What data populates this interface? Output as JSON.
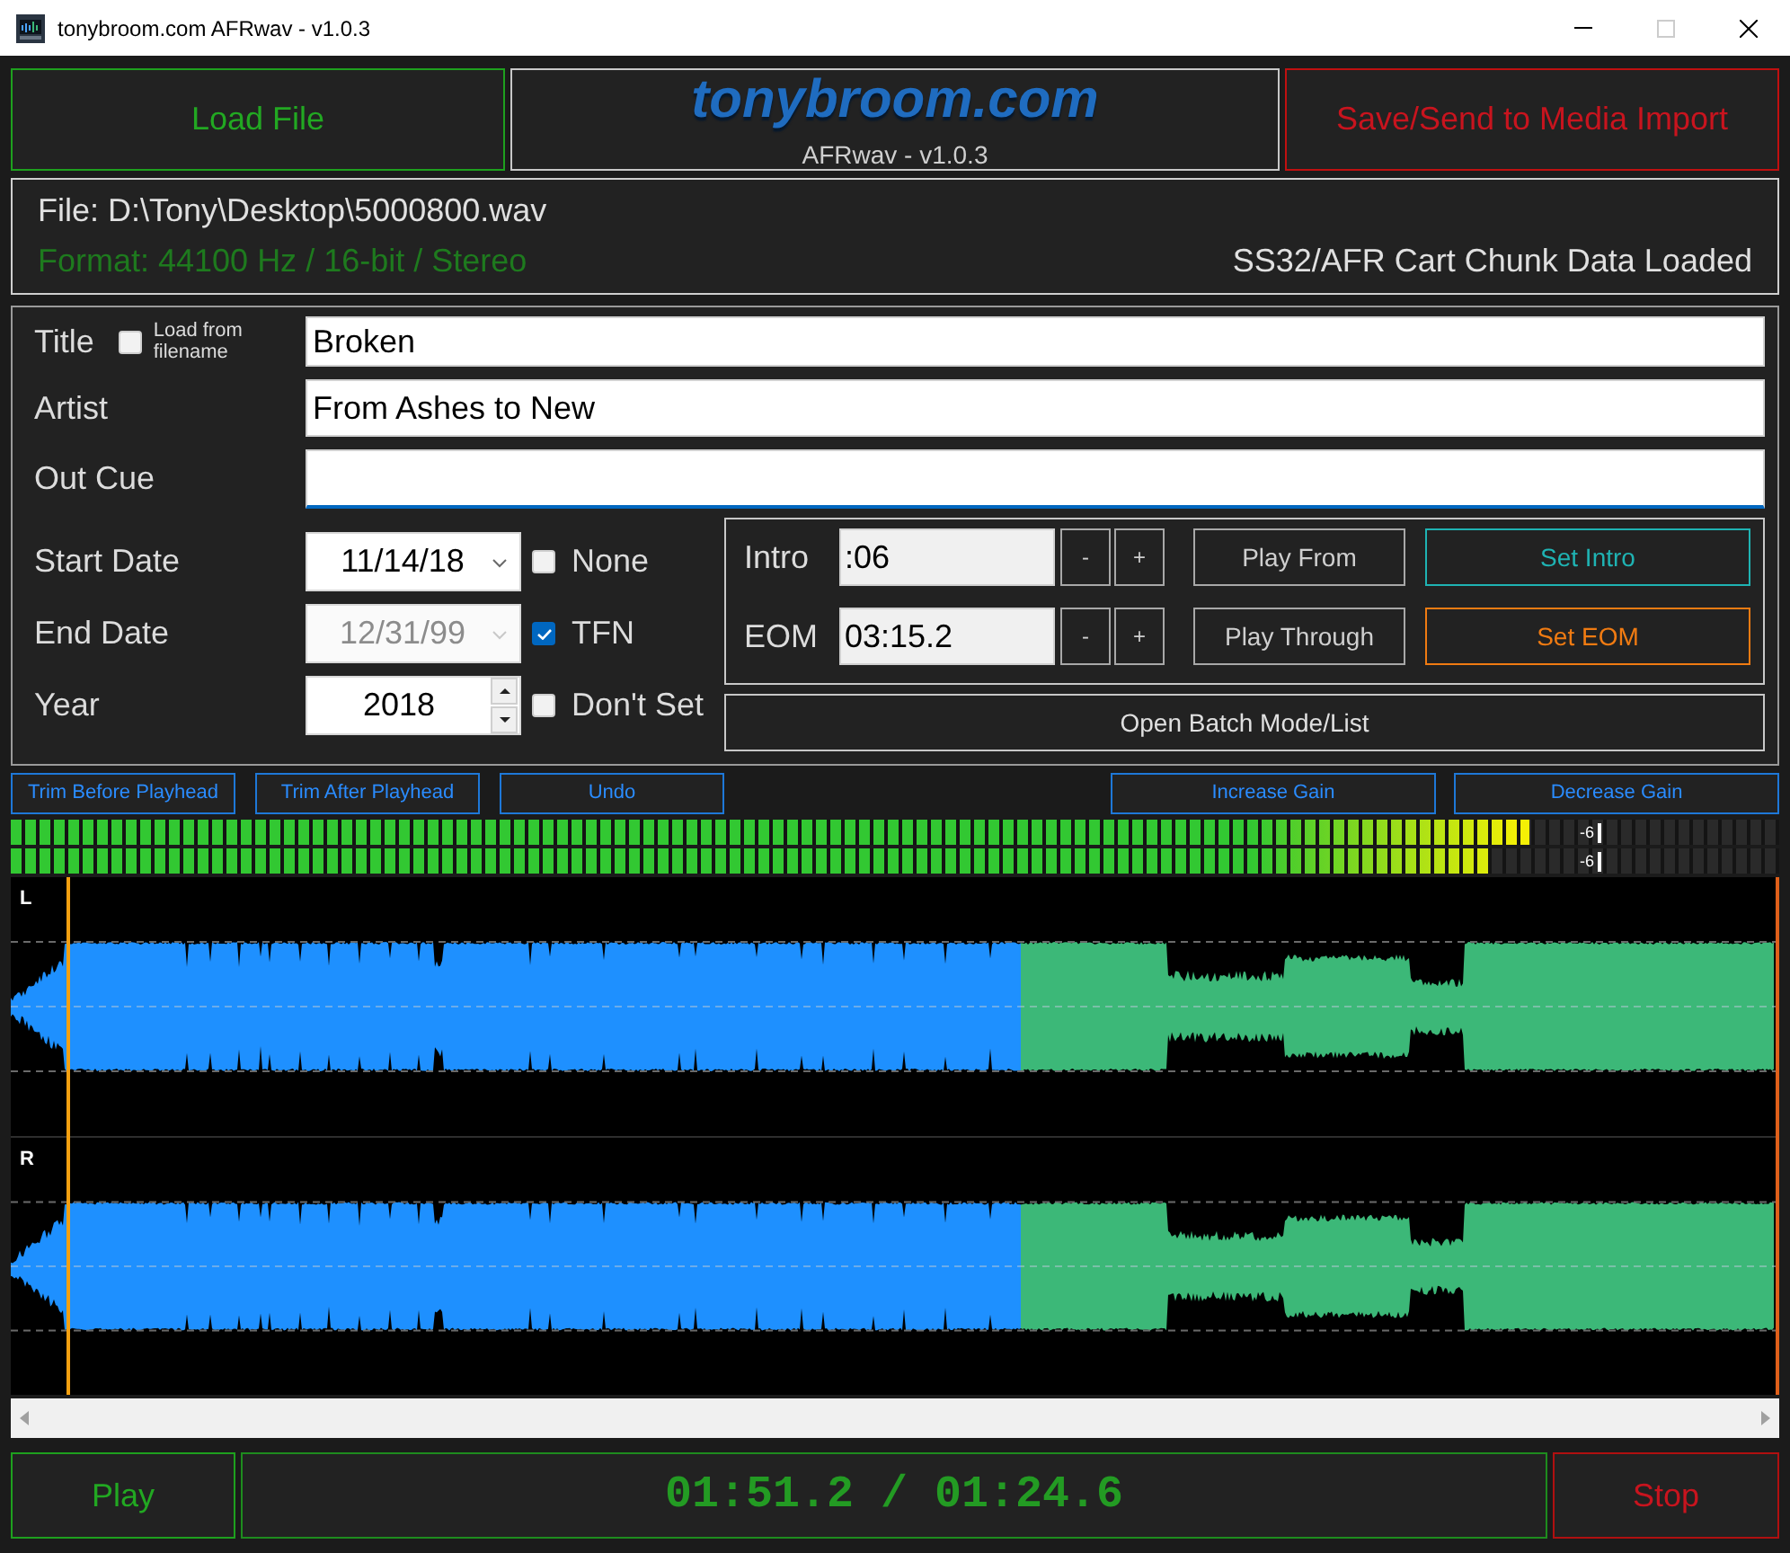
{
  "window": {
    "title": "tonybroom.com AFRwav - v1.0.3",
    "maximize": {
      "disabled": true
    }
  },
  "header": {
    "load_button": "Load File",
    "logo": {
      "brand": "tonybroom.com",
      "subtitle": "AFRwav - v1.0.3"
    },
    "save_button": "Save/Send to Media Import"
  },
  "file_info": {
    "file": "File: D:\\Tony\\Desktop\\5000800.wav",
    "format": "Format: 44100 Hz / 16-bit / Stereo",
    "status": "SS32/AFR Cart Chunk Data Loaded"
  },
  "fields": [
    {
      "label": "Title",
      "value": "Broken",
      "focused": false,
      "option": {
        "label": "Load from filename",
        "checked": false
      }
    },
    {
      "label": "Artist",
      "value": "From Ashes to New",
      "focused": false
    },
    {
      "label": "Out Cue",
      "focused": true
    }
  ],
  "dates": [
    {
      "kind": "date",
      "label": "Start Date",
      "value": "11/14/18",
      "disabled": false,
      "option": {
        "label": "None",
        "checked": false
      }
    },
    {
      "kind": "date",
      "label": "End Date",
      "value": "12/31/99",
      "disabled": true,
      "option": {
        "label": "TFN",
        "checked": true
      }
    },
    {
      "kind": "number",
      "label": "Year",
      "value": "2018",
      "disabled": false,
      "option": {
        "label": "Don't Set",
        "checked": false
      }
    }
  ],
  "markers": [
    {
      "label": "Intro",
      "value": ":06",
      "decrement": "-",
      "increment": "+",
      "play_button": "Play From",
      "set_button": "Set Intro",
      "color": "#1fb3b3"
    },
    {
      "label": "EOM",
      "value": "03:15.2",
      "decrement": "-",
      "increment": "+",
      "play_button": "Play Through",
      "set_button": "Set EOM",
      "color": "#f07b12"
    }
  ],
  "batch_button": "Open Batch Mode/List",
  "edit_tools": {
    "left": [
      "Trim Before Playhead",
      "Trim After Playhead",
      "Undo"
    ],
    "right": [
      "Increase Gain",
      "Decrease Gain"
    ]
  },
  "meters": [
    {
      "level": 0.859,
      "scale_label": "-6"
    },
    {
      "level": 0.837,
      "scale_label": "-6"
    }
  ],
  "waveform": {
    "channels": [
      {
        "label": "L"
      },
      {
        "label": "R"
      }
    ],
    "progress": {
      "level": 0.571
    },
    "cue_lines": [
      {
        "level": 0.031,
        "color": "#f5a010"
      },
      {
        "level": 0.998,
        "color": "#e0601a"
      }
    ]
  },
  "transport": {
    "play_button": "Play",
    "time": "01:51.2 / 01:24.6",
    "stop_button": "Stop"
  }
}
